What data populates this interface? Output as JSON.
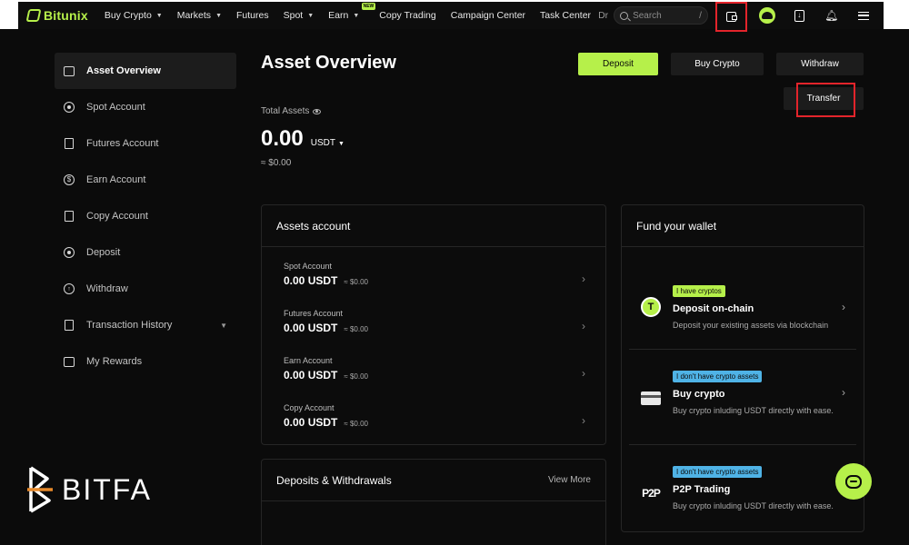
{
  "app": {
    "brand": "Bitunix"
  },
  "topnav": {
    "items": [
      {
        "label": "Buy Crypto",
        "caret": true
      },
      {
        "label": "Markets",
        "caret": true
      },
      {
        "label": "Futures",
        "caret": false
      },
      {
        "label": "Spot",
        "caret": true
      },
      {
        "label": "Earn",
        "caret": true,
        "badge": "NEW"
      },
      {
        "label": "Copy Trading",
        "caret": false
      },
      {
        "label": "Campaign Center",
        "caret": false
      },
      {
        "label": "Task Center",
        "caret": false
      }
    ],
    "overflow_fragment": "Dr",
    "search": {
      "placeholder": "Search",
      "shortcut": "/"
    },
    "icons": [
      "wallet-icon",
      "avatar",
      "download-icon",
      "bell-icon",
      "menu-icon"
    ]
  },
  "sidebar": {
    "items": [
      {
        "label": "Asset Overview",
        "icon": "wallet-icon",
        "active": true
      },
      {
        "label": "Spot Account",
        "icon": "spot-icon"
      },
      {
        "label": "Futures Account",
        "icon": "futures-icon"
      },
      {
        "label": "Earn Account",
        "icon": "earn-icon"
      },
      {
        "label": "Copy Account",
        "icon": "copy-icon"
      },
      {
        "label": "Deposit",
        "icon": "deposit-icon"
      },
      {
        "label": "Withdraw",
        "icon": "withdraw-icon"
      },
      {
        "label": "Transaction History",
        "icon": "history-icon",
        "expandable": true
      },
      {
        "label": "My Rewards",
        "icon": "rewards-icon"
      }
    ]
  },
  "main": {
    "title": "Asset Overview",
    "actions": {
      "deposit": "Deposit",
      "buy": "Buy Crypto",
      "withdraw": "Withdraw",
      "transfer": "Transfer"
    },
    "total": {
      "label": "Total Assets",
      "value": "0.00",
      "unit": "USDT",
      "fiat": "≈ $0.00"
    },
    "assets_account": {
      "title": "Assets account",
      "rows": [
        {
          "name": "Spot Account",
          "value": "0.00 USDT",
          "fiat": "≈ $0.00"
        },
        {
          "name": "Futures Account",
          "value": "0.00 USDT",
          "fiat": "≈ $0.00"
        },
        {
          "name": "Earn Account",
          "value": "0.00 USDT",
          "fiat": "≈ $0.00"
        },
        {
          "name": "Copy Account",
          "value": "0.00 USDT",
          "fiat": "≈ $0.00"
        }
      ]
    },
    "deposits_withdrawals": {
      "title": "Deposits & Withdrawals",
      "view_more": "View More"
    },
    "fund_wallet": {
      "title": "Fund your wallet",
      "items": [
        {
          "tag": "I have cryptos",
          "name": "Deposit on-chain",
          "desc": "Deposit your existing assets via blockchain",
          "icon": "tether-icon"
        },
        {
          "tag": "I don't have crypto assets",
          "name": "Buy crypto",
          "desc": "Buy crypto inluding USDT directly with ease.",
          "icon": "card-icon"
        },
        {
          "tag": "I don't have crypto assets",
          "name": "P2P Trading",
          "desc": "Buy crypto inluding USDT directly with ease.",
          "icon": "p2p-icon"
        }
      ]
    }
  },
  "watermark": {
    "text": "BITFA"
  },
  "colors": {
    "accent": "#b6f04a",
    "highlight": "#e3242b",
    "tag_blue": "#4fb3e6",
    "bg": "#0b0b0b"
  }
}
